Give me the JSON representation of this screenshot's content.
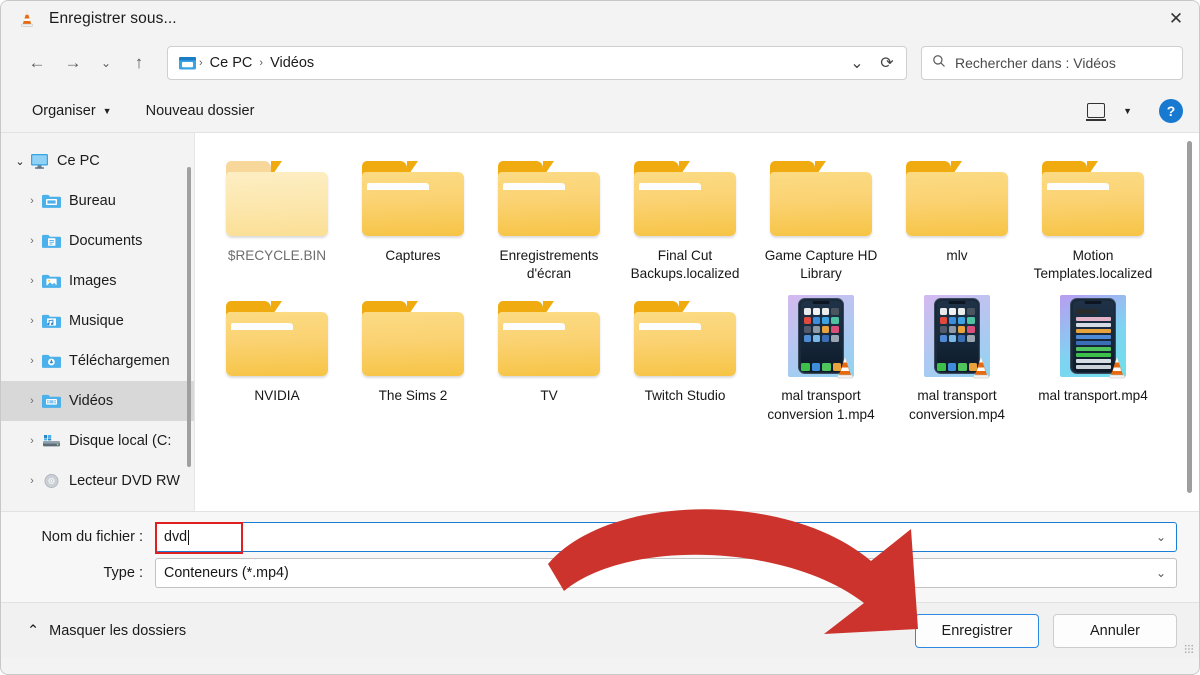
{
  "window": {
    "title": "Enregistrer sous...",
    "app_icon": "vlc-cone-icon",
    "close_label": "✕"
  },
  "navigation": {
    "back_icon": "←",
    "forward_icon": "→",
    "recent_icon": "⌄",
    "up_icon": "↑",
    "breadcrumb": [
      "Ce PC",
      "Vidéos"
    ],
    "breadcrumb_separator": "›",
    "dropdown_icon": "⌄",
    "refresh_icon": "⟳"
  },
  "search": {
    "icon": "search-icon",
    "placeholder": "Rechercher dans : Vidéos"
  },
  "toolbar": {
    "organize_label": "Organiser",
    "organize_caret": "▼",
    "new_folder_label": "Nouveau dossier",
    "view_caret": "▼",
    "help_label": "?"
  },
  "sidebar": {
    "items": [
      {
        "label": "Ce PC",
        "icon": "monitor-icon",
        "depth": 0,
        "expanded": true,
        "chevron": "⌄",
        "selected": false
      },
      {
        "label": "Bureau",
        "icon": "desktop-folder-icon",
        "depth": 1,
        "expanded": false,
        "chevron": "›",
        "selected": false
      },
      {
        "label": "Documents",
        "icon": "documents-folder-icon",
        "depth": 1,
        "expanded": false,
        "chevron": "›",
        "selected": false
      },
      {
        "label": "Images",
        "icon": "pictures-folder-icon",
        "depth": 1,
        "expanded": false,
        "chevron": "›",
        "selected": false
      },
      {
        "label": "Musique",
        "icon": "music-folder-icon",
        "depth": 1,
        "expanded": false,
        "chevron": "›",
        "selected": false
      },
      {
        "label": "Téléchargemen",
        "icon": "downloads-folder-icon",
        "depth": 1,
        "expanded": false,
        "chevron": "›",
        "selected": false
      },
      {
        "label": "Vidéos",
        "icon": "videos-folder-icon",
        "depth": 1,
        "expanded": false,
        "chevron": "›",
        "selected": true
      },
      {
        "label": "Disque local (C:",
        "icon": "hard-drive-icon",
        "depth": 1,
        "expanded": false,
        "chevron": "›",
        "selected": false
      },
      {
        "label": "Lecteur DVD RW",
        "icon": "dvd-drive-icon",
        "depth": 1,
        "expanded": false,
        "chevron": "›",
        "selected": false
      }
    ]
  },
  "files": [
    {
      "name": "$RECYCLE.BIN",
      "type": "folder",
      "dim": true
    },
    {
      "name": "Captures",
      "type": "folder",
      "dim": false
    },
    {
      "name": "Enregistrements d'écran",
      "type": "folder",
      "dim": false
    },
    {
      "name": "Final Cut Backups.localized",
      "type": "folder",
      "dim": false
    },
    {
      "name": "Game Capture HD Library",
      "type": "folder",
      "dim": false
    },
    {
      "name": "mlv",
      "type": "folder",
      "dim": false
    },
    {
      "name": "Motion Templates.localized",
      "type": "folder",
      "dim": false
    },
    {
      "name": "NVIDIA",
      "type": "folder",
      "dim": false
    },
    {
      "name": "The Sims 2",
      "type": "folder",
      "dim": false
    },
    {
      "name": "TV",
      "type": "folder",
      "dim": false
    },
    {
      "name": "Twitch Studio",
      "type": "folder",
      "dim": false
    },
    {
      "name": "mal transport conversion 1.mp4",
      "type": "video",
      "thumb": "phone-home-screen",
      "dim": false
    },
    {
      "name": "mal transport conversion.mp4",
      "type": "video",
      "thumb": "phone-home-screen",
      "dim": false
    },
    {
      "name": "mal transport.mp4",
      "type": "video",
      "thumb": "phone-settings-screen",
      "dim": false
    }
  ],
  "form": {
    "filename_label": "Nom du fichier :",
    "filename_value": "dvd",
    "filetype_label": "Type :",
    "filetype_value": "Conteneurs (*.mp4)",
    "dropdown_icon": "⌄"
  },
  "footer": {
    "hide_folders_label": "Masquer les dossiers",
    "hide_folders_chevron": "⌃",
    "save_label": "Enregistrer",
    "cancel_label": "Annuler"
  },
  "annotations": {
    "highlight_color": "#e02020",
    "arrow_color": "#cc332c",
    "arrow_target": "Enregistrer"
  }
}
